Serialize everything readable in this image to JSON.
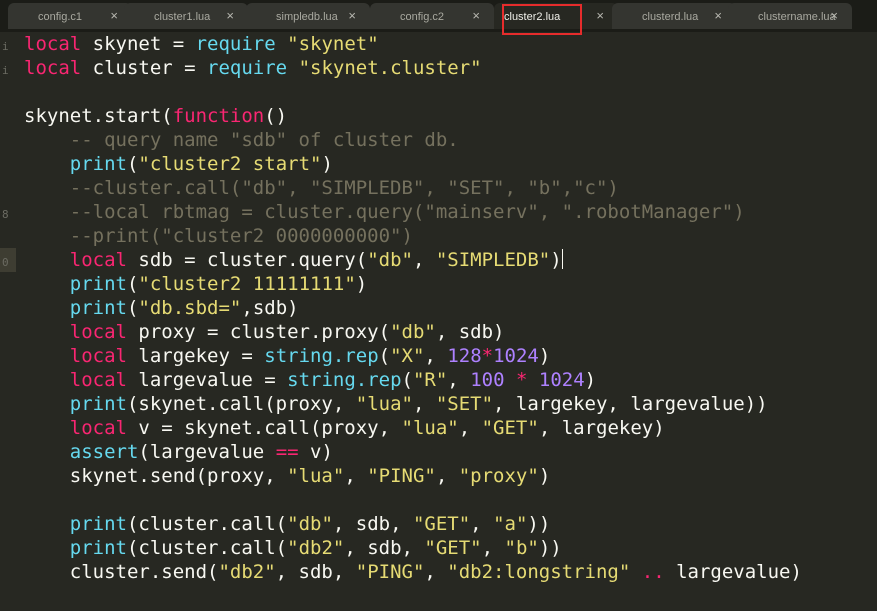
{
  "tabs": [
    {
      "label": "config.c1",
      "close": "×"
    },
    {
      "label": "cluster1.lua",
      "close": "×"
    },
    {
      "label": "simpledb.lua",
      "close": "×"
    },
    {
      "label": "config.c2",
      "close": "×"
    },
    {
      "label": "cluster2.lua",
      "close": "×",
      "active": true
    },
    {
      "label": "clusterd.lua",
      "close": "×"
    },
    {
      "label": "clustername.lua",
      "close": "×"
    }
  ],
  "colors": {
    "background": "#272822",
    "keyword": "#f92672",
    "function": "#66d9ef",
    "string": "#e6db74",
    "comment": "#75715e",
    "number": "#ae81ff",
    "highlight_box": "#e62c2c"
  },
  "editor": {
    "file": "cluster2.lua",
    "cursor_line": 10,
    "lines": [
      [
        [
          "kw",
          "local"
        ],
        [
          "tx",
          " skynet = "
        ],
        [
          "fn",
          "require"
        ],
        [
          "tx",
          " "
        ],
        [
          "str",
          "\"skynet\""
        ]
      ],
      [
        [
          "kw",
          "local"
        ],
        [
          "tx",
          " cluster = "
        ],
        [
          "fn",
          "require"
        ],
        [
          "tx",
          " "
        ],
        [
          "str",
          "\"skynet.cluster\""
        ]
      ],
      [],
      [
        [
          "tx",
          "skynet.start("
        ],
        [
          "kw",
          "function"
        ],
        [
          "tx",
          "()"
        ]
      ],
      [
        [
          "tx",
          "    "
        ],
        [
          "cm",
          "-- query name \"sdb\" of cluster db."
        ]
      ],
      [
        [
          "tx",
          "    "
        ],
        [
          "fn",
          "print"
        ],
        [
          "tx",
          "("
        ],
        [
          "str",
          "\"cluster2 start\""
        ],
        [
          "tx",
          ")"
        ]
      ],
      [
        [
          "tx",
          "    "
        ],
        [
          "cm",
          "--cluster.call(\"db\", \"SIMPLEDB\", \"SET\", \"b\",\"c\")"
        ]
      ],
      [
        [
          "tx",
          "    "
        ],
        [
          "cm",
          "--local rbtmag = cluster.query(\"mainserv\", \".robotManager\")"
        ]
      ],
      [
        [
          "tx",
          "    "
        ],
        [
          "cm",
          "--print(\"cluster2 0000000000\")"
        ]
      ],
      [
        [
          "tx",
          "    "
        ],
        [
          "kw",
          "local"
        ],
        [
          "tx",
          " sdb = cluster.query("
        ],
        [
          "str",
          "\"db\""
        ],
        [
          "tx",
          ", "
        ],
        [
          "str",
          "\"SIMPLEDB\""
        ],
        [
          "tx",
          ")"
        ],
        [
          "cursor",
          ""
        ]
      ],
      [
        [
          "tx",
          "    "
        ],
        [
          "fn",
          "print"
        ],
        [
          "tx",
          "("
        ],
        [
          "str",
          "\"cluster2 11111111\""
        ],
        [
          "tx",
          ")"
        ]
      ],
      [
        [
          "tx",
          "    "
        ],
        [
          "fn",
          "print"
        ],
        [
          "tx",
          "("
        ],
        [
          "str",
          "\"db.sbd=\""
        ],
        [
          "tx",
          ",sdb)"
        ]
      ],
      [
        [
          "tx",
          "    "
        ],
        [
          "kw",
          "local"
        ],
        [
          "tx",
          " proxy = cluster.proxy("
        ],
        [
          "str",
          "\"db\""
        ],
        [
          "tx",
          ", sdb)"
        ]
      ],
      [
        [
          "tx",
          "    "
        ],
        [
          "kw",
          "local"
        ],
        [
          "tx",
          " largekey = "
        ],
        [
          "fn",
          "string.rep"
        ],
        [
          "tx",
          "("
        ],
        [
          "str",
          "\"X\""
        ],
        [
          "tx",
          ", "
        ],
        [
          "num",
          "128"
        ],
        [
          "op",
          "*"
        ],
        [
          "num",
          "1024"
        ],
        [
          "tx",
          ")"
        ]
      ],
      [
        [
          "tx",
          "    "
        ],
        [
          "kw",
          "local"
        ],
        [
          "tx",
          " largevalue = "
        ],
        [
          "fn",
          "string.rep"
        ],
        [
          "tx",
          "("
        ],
        [
          "str",
          "\"R\""
        ],
        [
          "tx",
          ", "
        ],
        [
          "num",
          "100"
        ],
        [
          "tx",
          " "
        ],
        [
          "op",
          "*"
        ],
        [
          "tx",
          " "
        ],
        [
          "num",
          "1024"
        ],
        [
          "tx",
          ")"
        ]
      ],
      [
        [
          "tx",
          "    "
        ],
        [
          "fn",
          "print"
        ],
        [
          "tx",
          "(skynet.call(proxy, "
        ],
        [
          "str",
          "\"lua\""
        ],
        [
          "tx",
          ", "
        ],
        [
          "str",
          "\"SET\""
        ],
        [
          "tx",
          ", largekey, largevalue))"
        ]
      ],
      [
        [
          "tx",
          "    "
        ],
        [
          "kw",
          "local"
        ],
        [
          "tx",
          " v = skynet.call(proxy, "
        ],
        [
          "str",
          "\"lua\""
        ],
        [
          "tx",
          ", "
        ],
        [
          "str",
          "\"GET\""
        ],
        [
          "tx",
          ", largekey)"
        ]
      ],
      [
        [
          "tx",
          "    "
        ],
        [
          "fn",
          "assert"
        ],
        [
          "tx",
          "(largevalue "
        ],
        [
          "op",
          "=="
        ],
        [
          "tx",
          " v)"
        ]
      ],
      [
        [
          "tx",
          "    skynet.send(proxy, "
        ],
        [
          "str",
          "\"lua\""
        ],
        [
          "tx",
          ", "
        ],
        [
          "str",
          "\"PING\""
        ],
        [
          "tx",
          ", "
        ],
        [
          "str",
          "\"proxy\""
        ],
        [
          "tx",
          ")"
        ]
      ],
      [],
      [
        [
          "tx",
          "    "
        ],
        [
          "fn",
          "print"
        ],
        [
          "tx",
          "(cluster.call("
        ],
        [
          "str",
          "\"db\""
        ],
        [
          "tx",
          ", sdb, "
        ],
        [
          "str",
          "\"GET\""
        ],
        [
          "tx",
          ", "
        ],
        [
          "str",
          "\"a\""
        ],
        [
          "tx",
          "))"
        ]
      ],
      [
        [
          "tx",
          "    "
        ],
        [
          "fn",
          "print"
        ],
        [
          "tx",
          "(cluster.call("
        ],
        [
          "str",
          "\"db2\""
        ],
        [
          "tx",
          ", sdb, "
        ],
        [
          "str",
          "\"GET\""
        ],
        [
          "tx",
          ", "
        ],
        [
          "str",
          "\"b\""
        ],
        [
          "tx",
          "))"
        ]
      ],
      [
        [
          "tx",
          "    cluster.send("
        ],
        [
          "str",
          "\"db2\""
        ],
        [
          "tx",
          ", sdb, "
        ],
        [
          "str",
          "\"PING\""
        ],
        [
          "tx",
          ", "
        ],
        [
          "str",
          "\"db2:longstring\""
        ],
        [
          "tx",
          " "
        ],
        [
          "op",
          ".."
        ],
        [
          "tx",
          " largevalue)"
        ]
      ]
    ],
    "gutter_marks": [
      "i",
      "i",
      "",
      "",
      "",
      "",
      "",
      "8",
      "",
      "0",
      "",
      "",
      "",
      "",
      "",
      "",
      "",
      "",
      "",
      "",
      "",
      "",
      ""
    ]
  }
}
